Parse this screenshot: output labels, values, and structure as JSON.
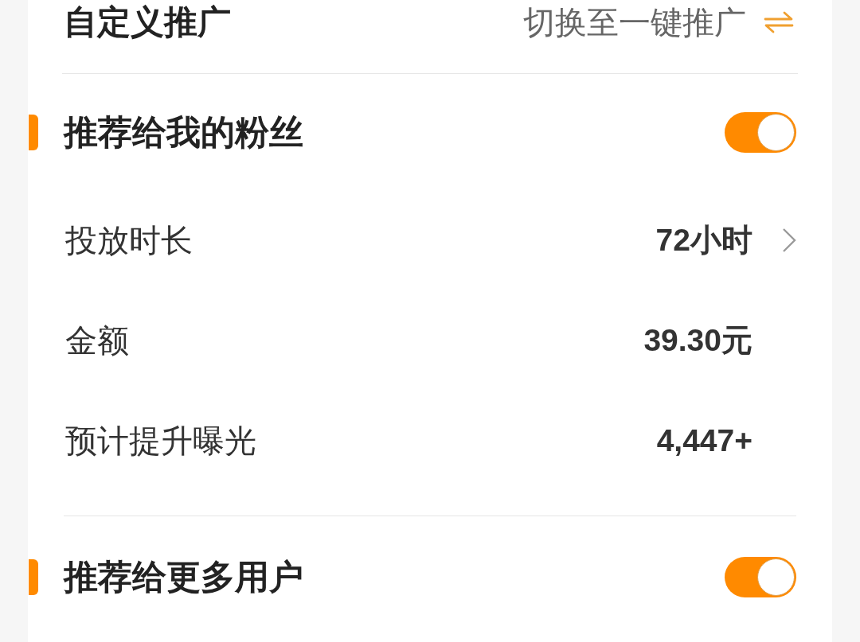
{
  "header": {
    "title": "自定义推广",
    "switch_link": "切换至一键推广"
  },
  "sections": [
    {
      "title": "推荐给我的粉丝",
      "on": true,
      "rows": [
        {
          "label": "投放时长",
          "value": "72小时",
          "kind": "link"
        },
        {
          "label": "金额",
          "value": "39.30元",
          "kind": "static"
        },
        {
          "label": "预计提升曝光",
          "value": "4,447+",
          "kind": "static"
        }
      ]
    },
    {
      "title": "推荐给更多用户",
      "on": true
    }
  ]
}
